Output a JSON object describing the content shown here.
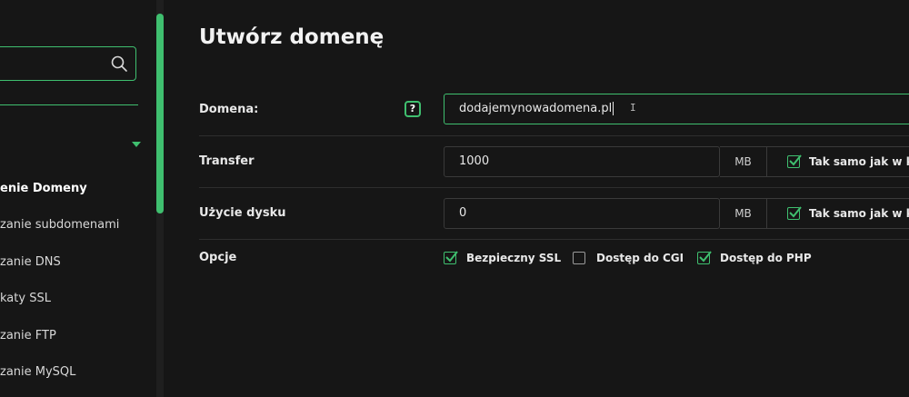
{
  "sidebar": {
    "items": [
      {
        "label": "enie Domeny"
      },
      {
        "label": "zanie subdomenami"
      },
      {
        "label": "zanie DNS"
      },
      {
        "label": "katy SSL"
      },
      {
        "label": "zanie FTP"
      },
      {
        "label": "zanie MySQL"
      }
    ]
  },
  "main": {
    "title": "Utwórz domenę",
    "domain": {
      "label": "Domena:",
      "help": "?",
      "value": "dodajemynowadomena.pl"
    },
    "transfer": {
      "label": "Transfer",
      "value": "1000",
      "unit": "MB",
      "same_label": "Tak samo jak w kon",
      "same_checked": true
    },
    "disk": {
      "label": "Użycie dysku",
      "value": "0",
      "unit": "MB",
      "same_label": "Tak samo jak w kon",
      "same_checked": true
    },
    "options": {
      "label": "Opcje",
      "items": [
        {
          "label": "Bezpieczny SSL",
          "checked": true
        },
        {
          "label": "Dostęp do CGI",
          "checked": false
        },
        {
          "label": "Dostęp do PHP",
          "checked": true
        }
      ]
    }
  },
  "colors": {
    "accent": "#3fbf6f",
    "background": "#161616",
    "border": "#3a3a3a"
  }
}
